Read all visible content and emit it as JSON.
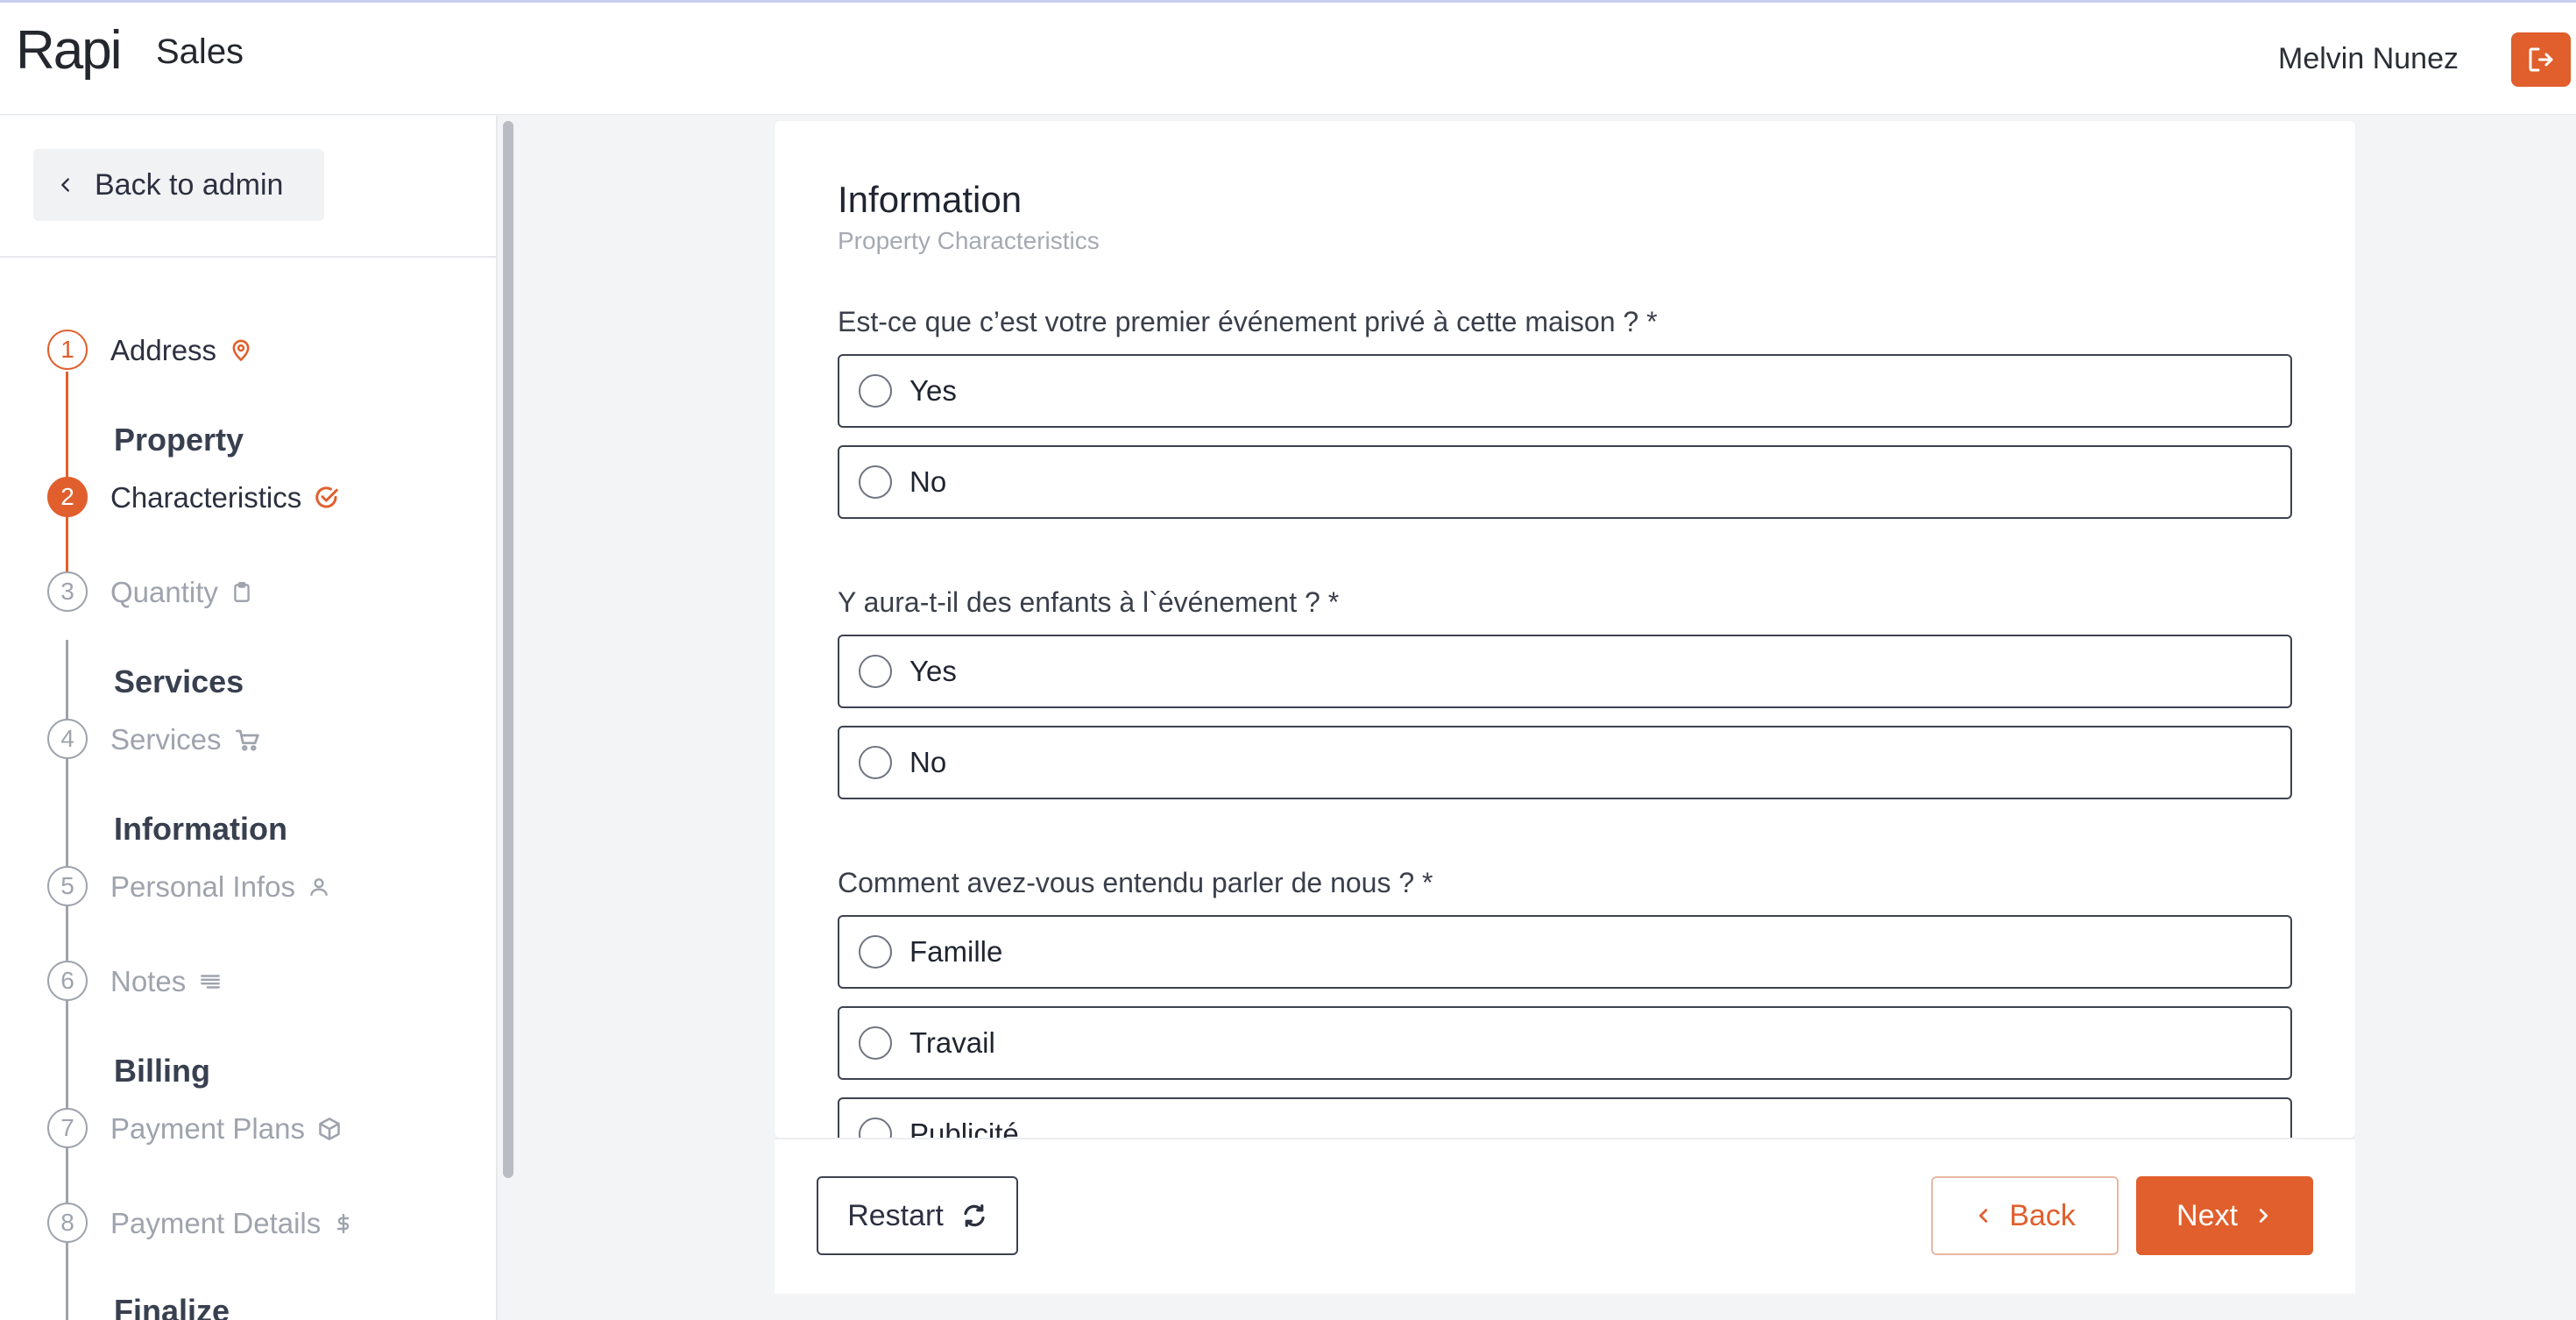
{
  "header": {
    "logo": "Rapi",
    "app_title": "Sales",
    "user_name": "Melvin Nunez"
  },
  "sidebar": {
    "back_label": "Back to admin",
    "groups": {
      "property": "Property",
      "services": "Services",
      "information": "Information",
      "billing": "Billing",
      "finalize": "Finalize"
    },
    "steps": [
      {
        "num": "1",
        "label": "Address",
        "icon": "map-pin-icon",
        "state": "done"
      },
      {
        "num": "2",
        "label": "Characteristics",
        "icon": "check-circle-icon",
        "state": "active"
      },
      {
        "num": "3",
        "label": "Quantity",
        "icon": "clipboard-icon",
        "state": "pending"
      },
      {
        "num": "4",
        "label": "Services",
        "icon": "cart-icon",
        "state": "pending"
      },
      {
        "num": "5",
        "label": "Personal Infos",
        "icon": "user-icon",
        "state": "pending"
      },
      {
        "num": "6",
        "label": "Notes",
        "icon": "lines-icon",
        "state": "pending"
      },
      {
        "num": "7",
        "label": "Payment Plans",
        "icon": "box-icon",
        "state": "pending"
      },
      {
        "num": "8",
        "label": "Payment Details",
        "icon": "dollar-icon",
        "state": "pending"
      }
    ]
  },
  "form": {
    "title": "Information",
    "subtitle": "Property Characteristics",
    "questions": [
      {
        "label": "Est-ce que c’est votre premier événement privé à cette maison ? *",
        "options": [
          "Yes",
          "No"
        ]
      },
      {
        "label": "Y aura-t-il des enfants à l`événement ? *",
        "options": [
          "Yes",
          "No"
        ]
      },
      {
        "label": "Comment avez-vous entendu parler de nous ? *",
        "options": [
          "Famille",
          "Travail",
          "Publicité"
        ]
      }
    ]
  },
  "footer": {
    "restart_label": "Restart",
    "back_label": "Back",
    "next_label": "Next"
  },
  "colors": {
    "accent": "#e05f2d",
    "text": "#1f2430",
    "muted": "#9ea3ad"
  }
}
